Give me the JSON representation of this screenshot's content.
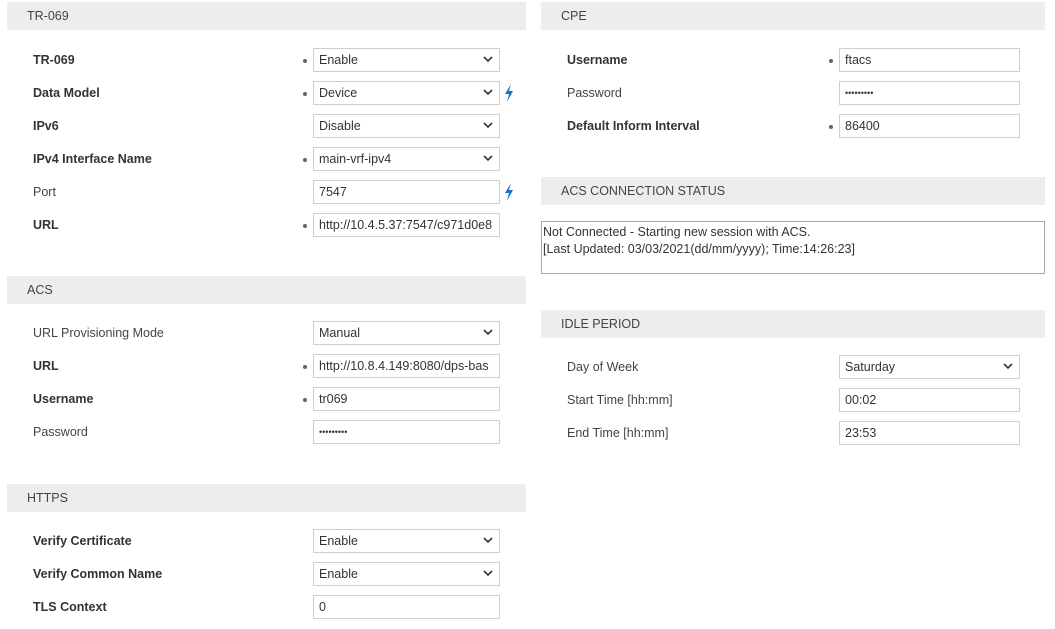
{
  "tr069": {
    "header": "TR-069",
    "rows": [
      {
        "label": "TR-069",
        "value": "Enable"
      },
      {
        "label": "Data Model",
        "value": "Device"
      },
      {
        "label": "IPv6",
        "value": "Disable"
      },
      {
        "label": "IPv4 Interface Name",
        "value": "main-vrf-ipv4"
      },
      {
        "label": "Port",
        "value": "7547"
      },
      {
        "label": "URL",
        "value": "http://10.4.5.37:7547/c971d0e8"
      }
    ]
  },
  "acs": {
    "header": "ACS",
    "rows": [
      {
        "label": "URL Provisioning Mode",
        "value": "Manual"
      },
      {
        "label": "URL",
        "value": "http://10.8.4.149:8080/dps-bas"
      },
      {
        "label": "Username",
        "value": "tr069"
      },
      {
        "label": "Password",
        "value": "•••••••••"
      }
    ]
  },
  "https": {
    "header": "HTTPS",
    "rows": [
      {
        "label": "Verify Certificate",
        "value": "Enable"
      },
      {
        "label": "Verify Common Name",
        "value": "Enable"
      },
      {
        "label": "TLS Context",
        "value": "0"
      }
    ]
  },
  "cpe": {
    "header": "CPE",
    "rows": [
      {
        "label": "Username",
        "value": "ftacs"
      },
      {
        "label": "Password",
        "value": "•••••••••"
      },
      {
        "label": "Default Inform Interval",
        "value": "86400"
      }
    ]
  },
  "acs_status": {
    "header": "ACS CONNECTION STATUS",
    "line1": "Not Connected - Starting new session with ACS.",
    "line2": "[Last Updated: 03/03/2021(dd/mm/yyyy); Time:14:26:23]"
  },
  "idle": {
    "header": "IDLE PERIOD",
    "rows": [
      {
        "label": "Day of Week",
        "value": "Saturday"
      },
      {
        "label": "Start Time [hh:mm]",
        "value": "00:02"
      },
      {
        "label": "End Time [hh:mm]",
        "value": "23:53"
      }
    ]
  }
}
